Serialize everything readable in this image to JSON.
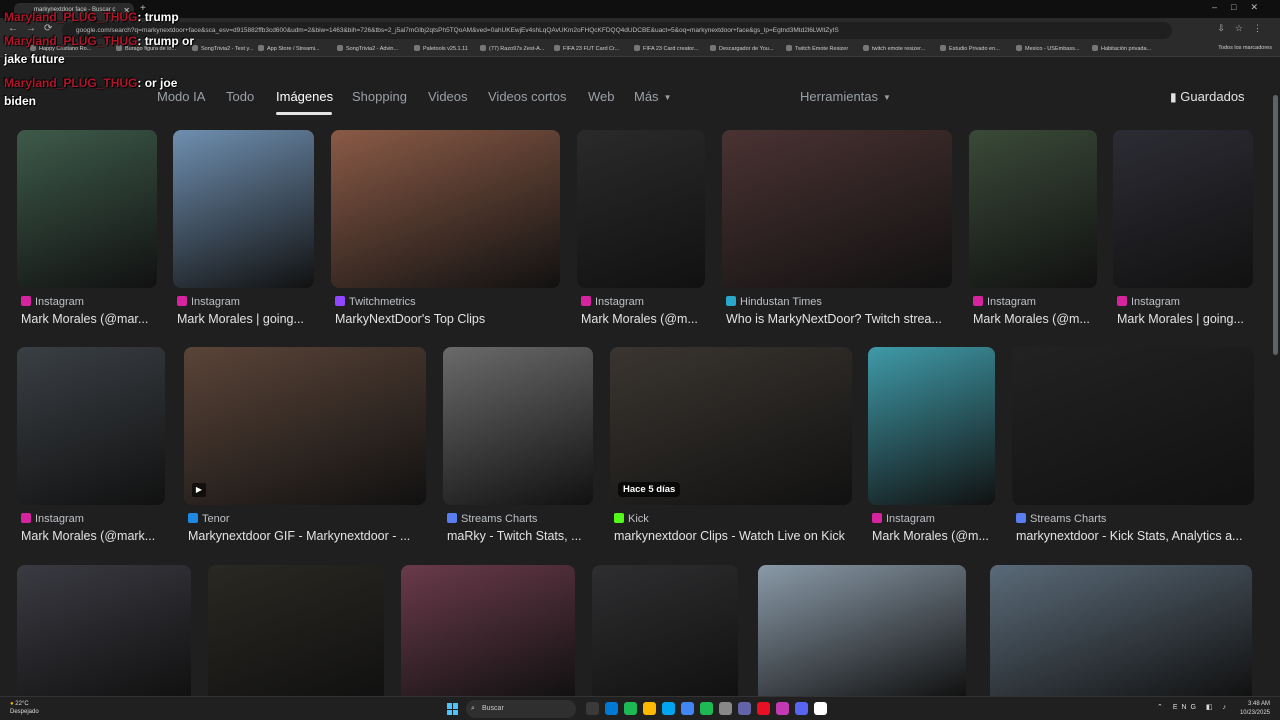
{
  "browser": {
    "tab_title": "markynextdoor face - Buscar c",
    "url": "google.com/search?q=markynextdoor+face&sca_esv=d915882ffb3cd600&udm=2&biw=1463&bih=726&tbs=2_j5al7mGlbj2qtsPh5TQoAM&ved=0ahUKEwjEv4shLqQAvUKm2oFHQcKFDQQ4dUDCBE&uact=5&oq=markynextdoor+face&gs_lp=Egtnd3Mtd2l6LWltZyIS",
    "bookmarks": [
      "Happy Cristiano Ro...",
      "Burago figura de lo...",
      "SongTrivia2 - Test y...",
      "App Store / Streami...",
      "SongTrivia2 - Advin...",
      "Paletools v25.1.11",
      "(77) Razo97s Zest-A...",
      "FIFA 23 FUT Card Cr...",
      "FIFA 23 Card creator...",
      "Descargador de You...",
      "Twitch Emote Resizer",
      "twitch emote resizer...",
      "Estudio Privado en...",
      "Mexico - USEmbass...",
      "Habitación privada..."
    ],
    "bookmarks_right": "Todos los marcadores"
  },
  "chat": [
    {
      "user": "Maryland_PLUG_THUG",
      "message": ": trump"
    },
    {
      "user": "Maryland_PLUG_THUG",
      "message": ": trump or jake future"
    },
    {
      "user": "Maryland_PLUG_THUG",
      "message": ": or joe biden"
    }
  ],
  "search_tabs": [
    "Modo IA",
    "Todo",
    "Imágenes",
    "Shopping",
    "Videos",
    "Videos cortos",
    "Web",
    "Más"
  ],
  "active_tab": "Imágenes",
  "tools_label": "Herramientas",
  "saved_label": "Guardados",
  "results": {
    "row1": [
      {
        "source": "Instagram",
        "title": "Mark Morales (@mar...",
        "color": "#3d5a4a"
      },
      {
        "source": "Instagram",
        "title": "Mark Morales | going...",
        "color": "#6f8fb0"
      },
      {
        "source": "Twitchmetrics",
        "title": "MarkyNextDoor's Top Clips",
        "color": "#8a5a46"
      },
      {
        "source": "Instagram",
        "title": "Mark Morales (@m...",
        "color": "#2a2a2a"
      },
      {
        "source": "Hindustan Times",
        "title": "Who is MarkyNextDoor? Twitch strea...",
        "color": "#4a3232"
      },
      {
        "source": "Instagram",
        "title": "Mark Morales (@m...",
        "color": "#3a4a38"
      },
      {
        "source": "Instagram",
        "title": "Mark Morales | going...",
        "color": "#2c2c34"
      }
    ],
    "row2": [
      {
        "source": "Instagram",
        "title": "Mark Morales (@mark...",
        "color": "#3a3f44"
      },
      {
        "source": "Tenor",
        "title": "Markynextdoor GIF - Markynextdoor - ...",
        "color": "#5a4438"
      },
      {
        "source": "Streams Charts",
        "title": "maRky - Twitch Stats, ...",
        "color": "#6a6a6a"
      },
      {
        "source": "Kick",
        "title": "markynextdoor Clips - Watch Live on Kick",
        "color": "#3a3530",
        "badge": "Hace 5 días"
      },
      {
        "source": "Instagram",
        "title": "Mark Morales (@m...",
        "color": "#3f9aa8"
      },
      {
        "source": "Streams Charts",
        "title": "markynextdoor - Kick Stats, Analytics a...",
        "color": "#222222"
      }
    ],
    "row3_colors": [
      "#3a3a42",
      "#2a2822",
      "#6a3a4a",
      "#2e2e30",
      "#8a9aa8",
      "#5a6a78"
    ]
  },
  "taskbar": {
    "weather_temp": "22°C",
    "weather_desc": "Despejado",
    "search": "Buscar",
    "lang": "ENG",
    "time": "3:48 AM",
    "date": "10/23/2025"
  }
}
